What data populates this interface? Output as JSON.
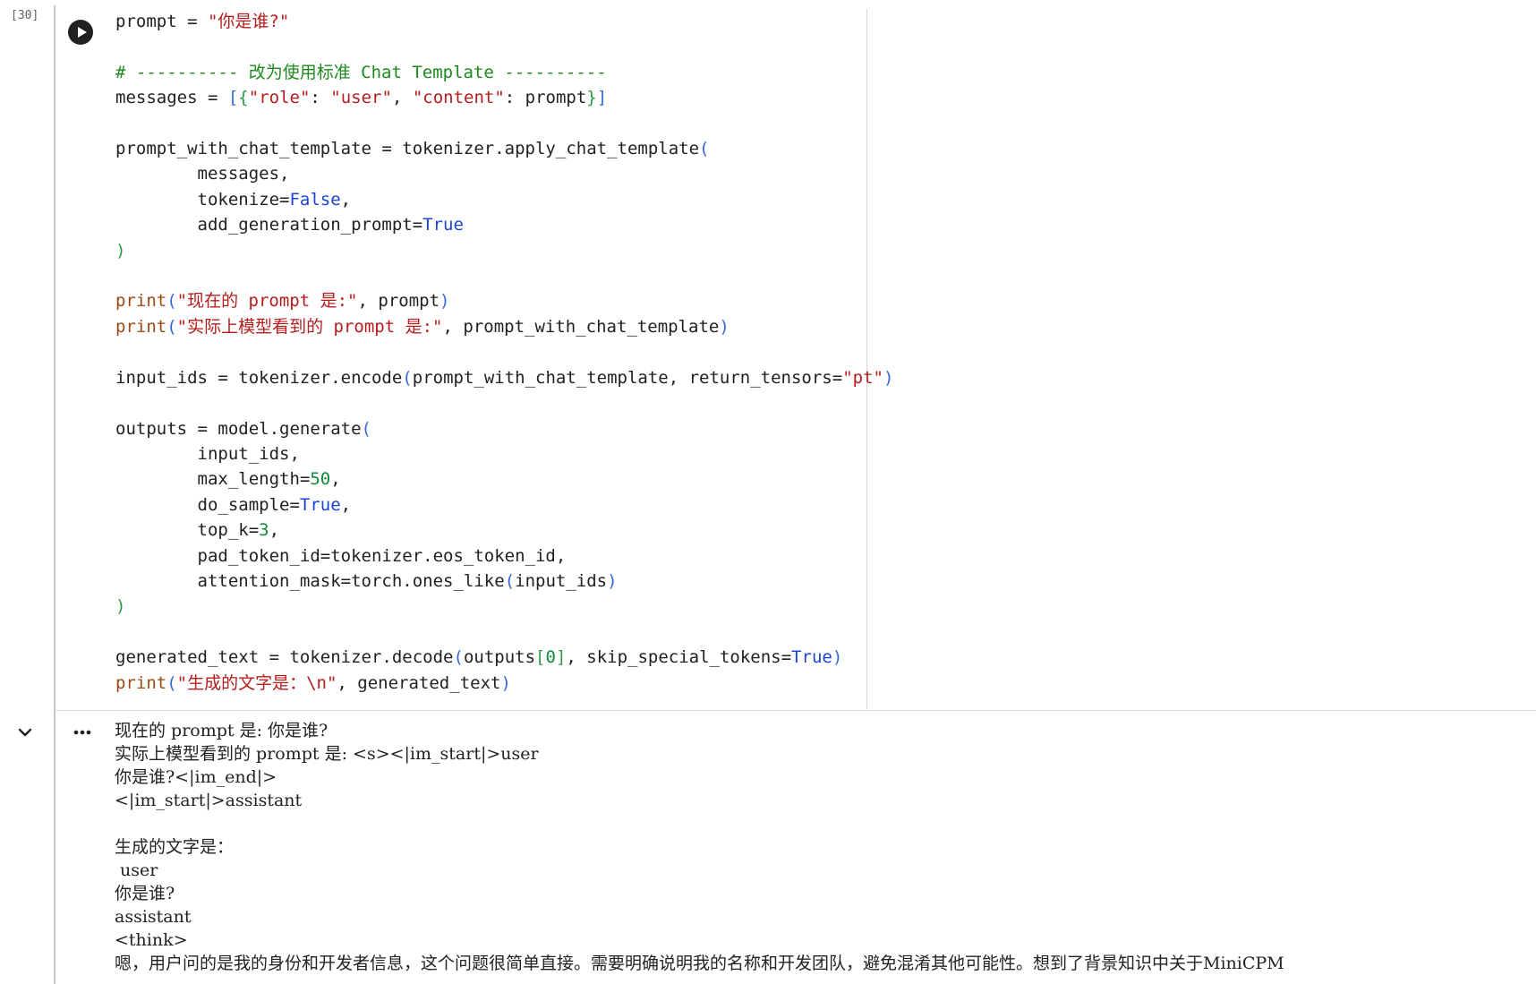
{
  "cell": {
    "execution_count": "[30]",
    "code_lines": [
      "prompt = \"你是谁?\"",
      "",
      "# ---------- 改为使用标准 Chat Template ----------",
      "messages = [{\"role\": \"user\", \"content\": prompt}]",
      "",
      "prompt_with_chat_template = tokenizer.apply_chat_template(",
      "        messages,",
      "        tokenize=False,",
      "        add_generation_prompt=True",
      ")",
      "",
      "print(\"现在的 prompt 是:\", prompt)",
      "print(\"实际上模型看到的 prompt 是:\", prompt_with_chat_template)",
      "",
      "input_ids = tokenizer.encode(prompt_with_chat_template, return_tensors=\"pt\")",
      "",
      "outputs = model.generate(",
      "        input_ids,",
      "        max_length=50,",
      "        do_sample=True,",
      "        top_k=3,",
      "        pad_token_id=tokenizer.eos_token_id,",
      "        attention_mask=torch.ones_like(input_ids)",
      ")",
      "",
      "generated_text = tokenizer.decode(outputs[0], skip_special_tokens=True)",
      "print(\"生成的文字是：\\n\", generated_text)"
    ]
  },
  "output": {
    "lines": [
      "现在的 prompt 是: 你是谁?",
      "实际上模型看到的 prompt 是: <s><|im_start|>user",
      "你是谁?<|im_end|>",
      "<|im_start|>assistant",
      "",
      "生成的文字是：",
      " user",
      "你是谁?",
      "assistant",
      "<think>",
      "嗯，用户问的是我的身份和开发者信息，这个问题很简单直接。需要明确说明我的名称和开发团队，避免混淆其他可能性。想到了背景知识中关于MiniCPM"
    ]
  },
  "icons": {
    "run": "play-circle-icon",
    "collapse": "chevron-down-icon",
    "more": "more-horizontal-icon"
  },
  "colors": {
    "keyword": "#1a44d6",
    "string": "#b71c1c",
    "builtin": "#9c4a15",
    "number": "#148a3b",
    "comment": "#1e8a1e"
  }
}
